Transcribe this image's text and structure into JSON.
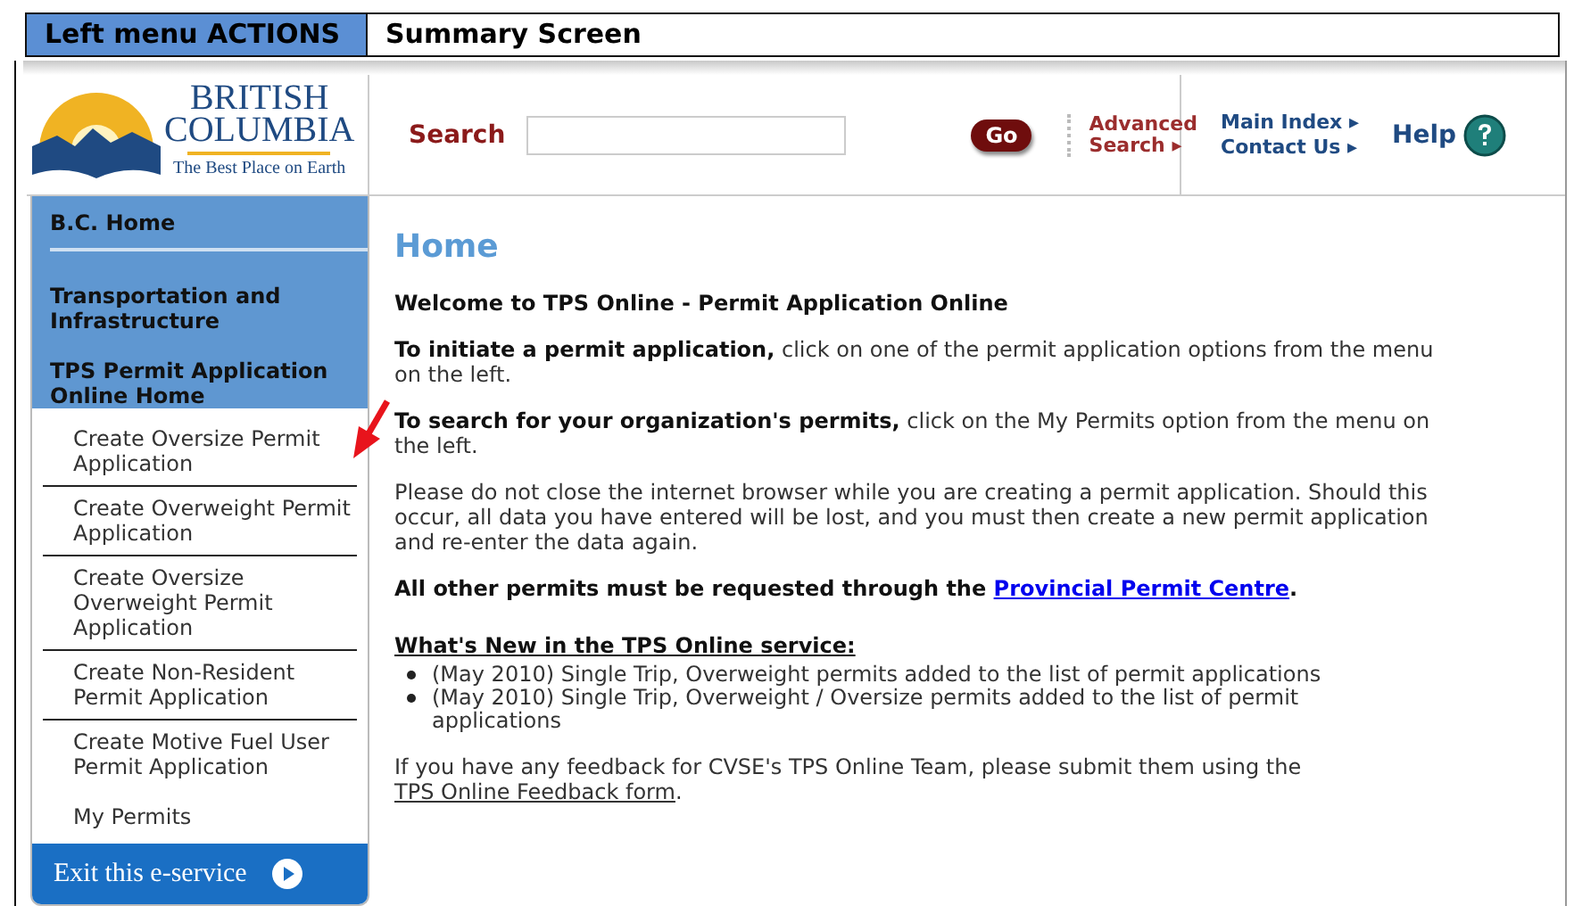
{
  "caption_bar": {
    "cells": [
      "Left menu ACTIONS",
      "Summary Screen"
    ]
  },
  "logo": {
    "line_1": "BRITISH",
    "line_2": "COLUMBIA",
    "tagline": "The Best Place on Earth"
  },
  "search": {
    "label": "Search",
    "button": "Go",
    "advanced": "Advanced Search ▸"
  },
  "top_links": [
    "Main Index ▸",
    "Contact Us ▸"
  ],
  "help": "Help",
  "sidebar": {
    "sections": [
      "B.C. Home",
      "Transportation and Infrastructure",
      "TPS Permit Application Online Home"
    ],
    "items": [
      "Create Oversize Permit Application",
      "Create Overweight Permit Application",
      "Create Oversize Overweight Permit Application",
      "Create Non-Resident Permit Application",
      "Create Motive Fuel User Permit Application",
      "My Permits"
    ],
    "exit": "Exit this e-service"
  },
  "content": {
    "title": "Home",
    "paragraphs": [
      {
        "kind": "bold",
        "text": "Welcome to TPS Online - Permit Application Online"
      },
      {
        "kind": "plain",
        "text": "**To initiate a permit application,** click on one of the permit application options from the menu on the left."
      },
      {
        "kind": "plain",
        "text": "**To search for your organization's permits,** click on the My Permits option from the menu on the left."
      },
      {
        "kind": "plain",
        "text": "Please do not close the internet browser while you are creating a permit application. Should this occur, all data you have entered will be lost, and you must then create a new permit application and re-enter the data again."
      },
      {
        "kind": "bold-link",
        "before": "All other permits must be requested through the ",
        "link": "Provincial Permit Centre",
        "after": "."
      }
    ],
    "news_heading": "What's New in the TPS Online service:",
    "news": [
      "(May 2010) Single Trip, Overweight permits added to the list of permit applications",
      "(May 2010) Single Trip, Overweight / Oversize permits added to the list of permit applications"
    ],
    "feedback": {
      "before": "If you have any feedback for CVSE's TPS Online Team, please submit them using the ",
      "link": "TPS Online Feedback form",
      "after": "."
    }
  }
}
